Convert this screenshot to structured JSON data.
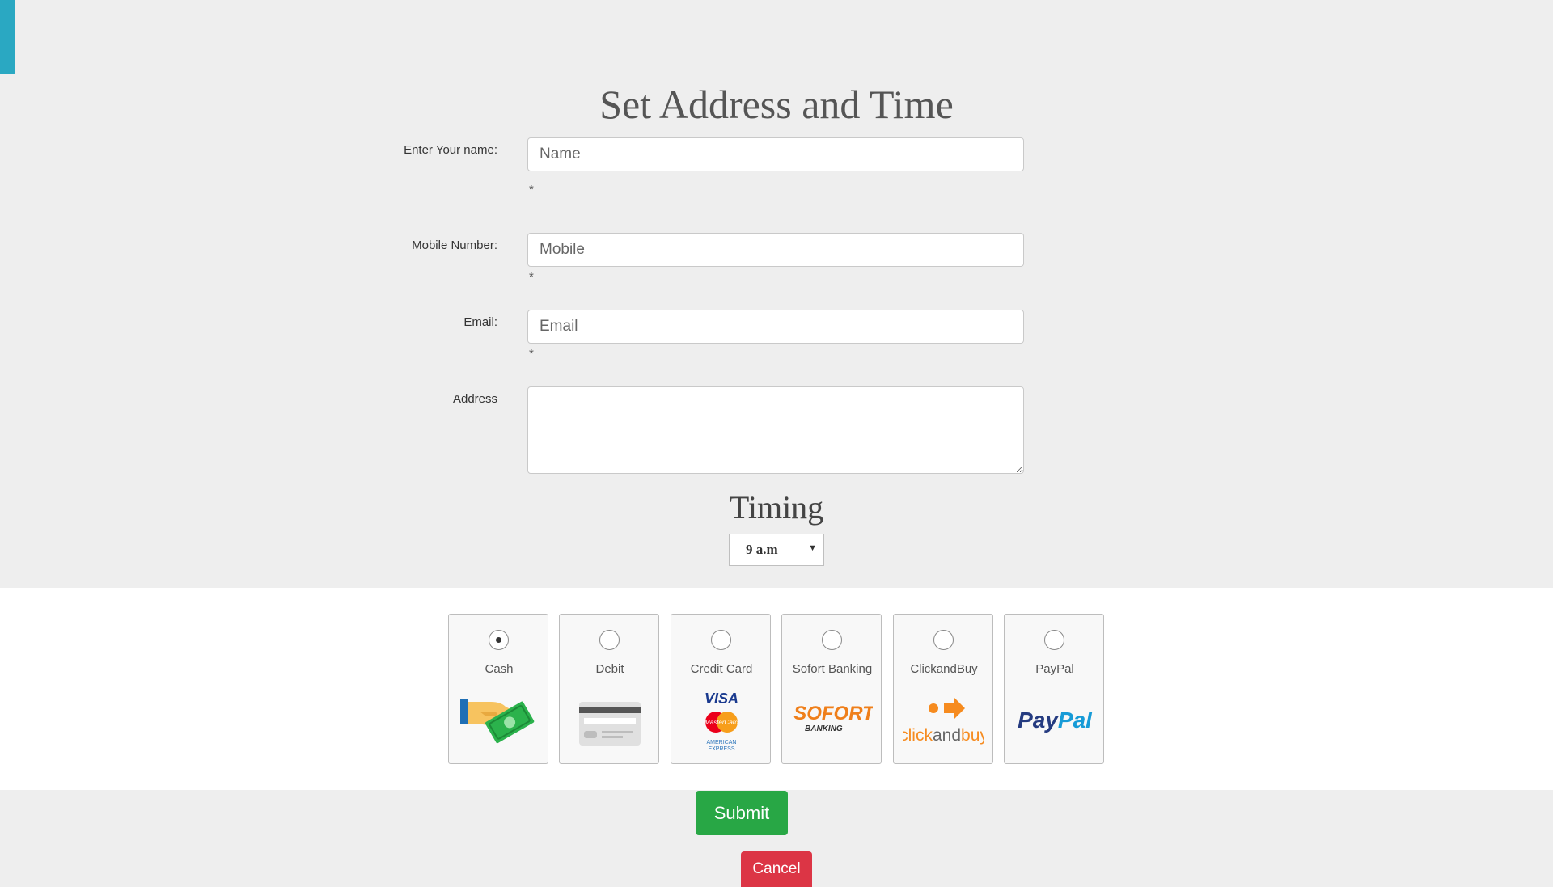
{
  "page": {
    "title": "Set Address and Time"
  },
  "form": {
    "name": {
      "label": "Enter Your name:",
      "placeholder": "Name",
      "required_mark": "*"
    },
    "mobile": {
      "label": "Mobile Number:",
      "placeholder": "Mobile",
      "required_mark": "*"
    },
    "email": {
      "label": "Email:",
      "placeholder": "Email",
      "required_mark": "*"
    },
    "address": {
      "label": "Address",
      "value": ""
    }
  },
  "timing": {
    "title": "Timing",
    "selected": "9 a.m"
  },
  "payment": {
    "selected": "Cash",
    "options": [
      {
        "label": "Cash",
        "icon": "cash-hand-icon",
        "checked": true
      },
      {
        "label": "Debit",
        "icon": "debit-card-icon",
        "checked": false
      },
      {
        "label": "Credit Card",
        "icon": "credit-card-brands-icon",
        "checked": false
      },
      {
        "label": "Sofort Banking",
        "icon": "sofort-logo",
        "checked": false
      },
      {
        "label": "ClickandBuy",
        "icon": "clickandbuy-logo",
        "checked": false
      },
      {
        "label": "PayPal",
        "icon": "paypal-logo",
        "checked": false
      }
    ],
    "logo_text": {
      "visa": "VISA",
      "mastercard": "MasterCard",
      "amex_line1": "AMERICAN",
      "amex_line2": "EXPRESS",
      "sofort": "SOFORT",
      "sofort_sub": "BANKING",
      "clickandbuy_click": "click",
      "clickandbuy_and": "and",
      "clickandbuy_buy": "buy",
      "paypal_pay": "Pay",
      "paypal_pal": "Pal"
    }
  },
  "buttons": {
    "submit": "Submit",
    "cancel": "Cancel"
  },
  "colors": {
    "accent_tab": "#2aa8c2",
    "submit": "#28a745",
    "cancel": "#dc3545",
    "background": "#eeeeee"
  }
}
